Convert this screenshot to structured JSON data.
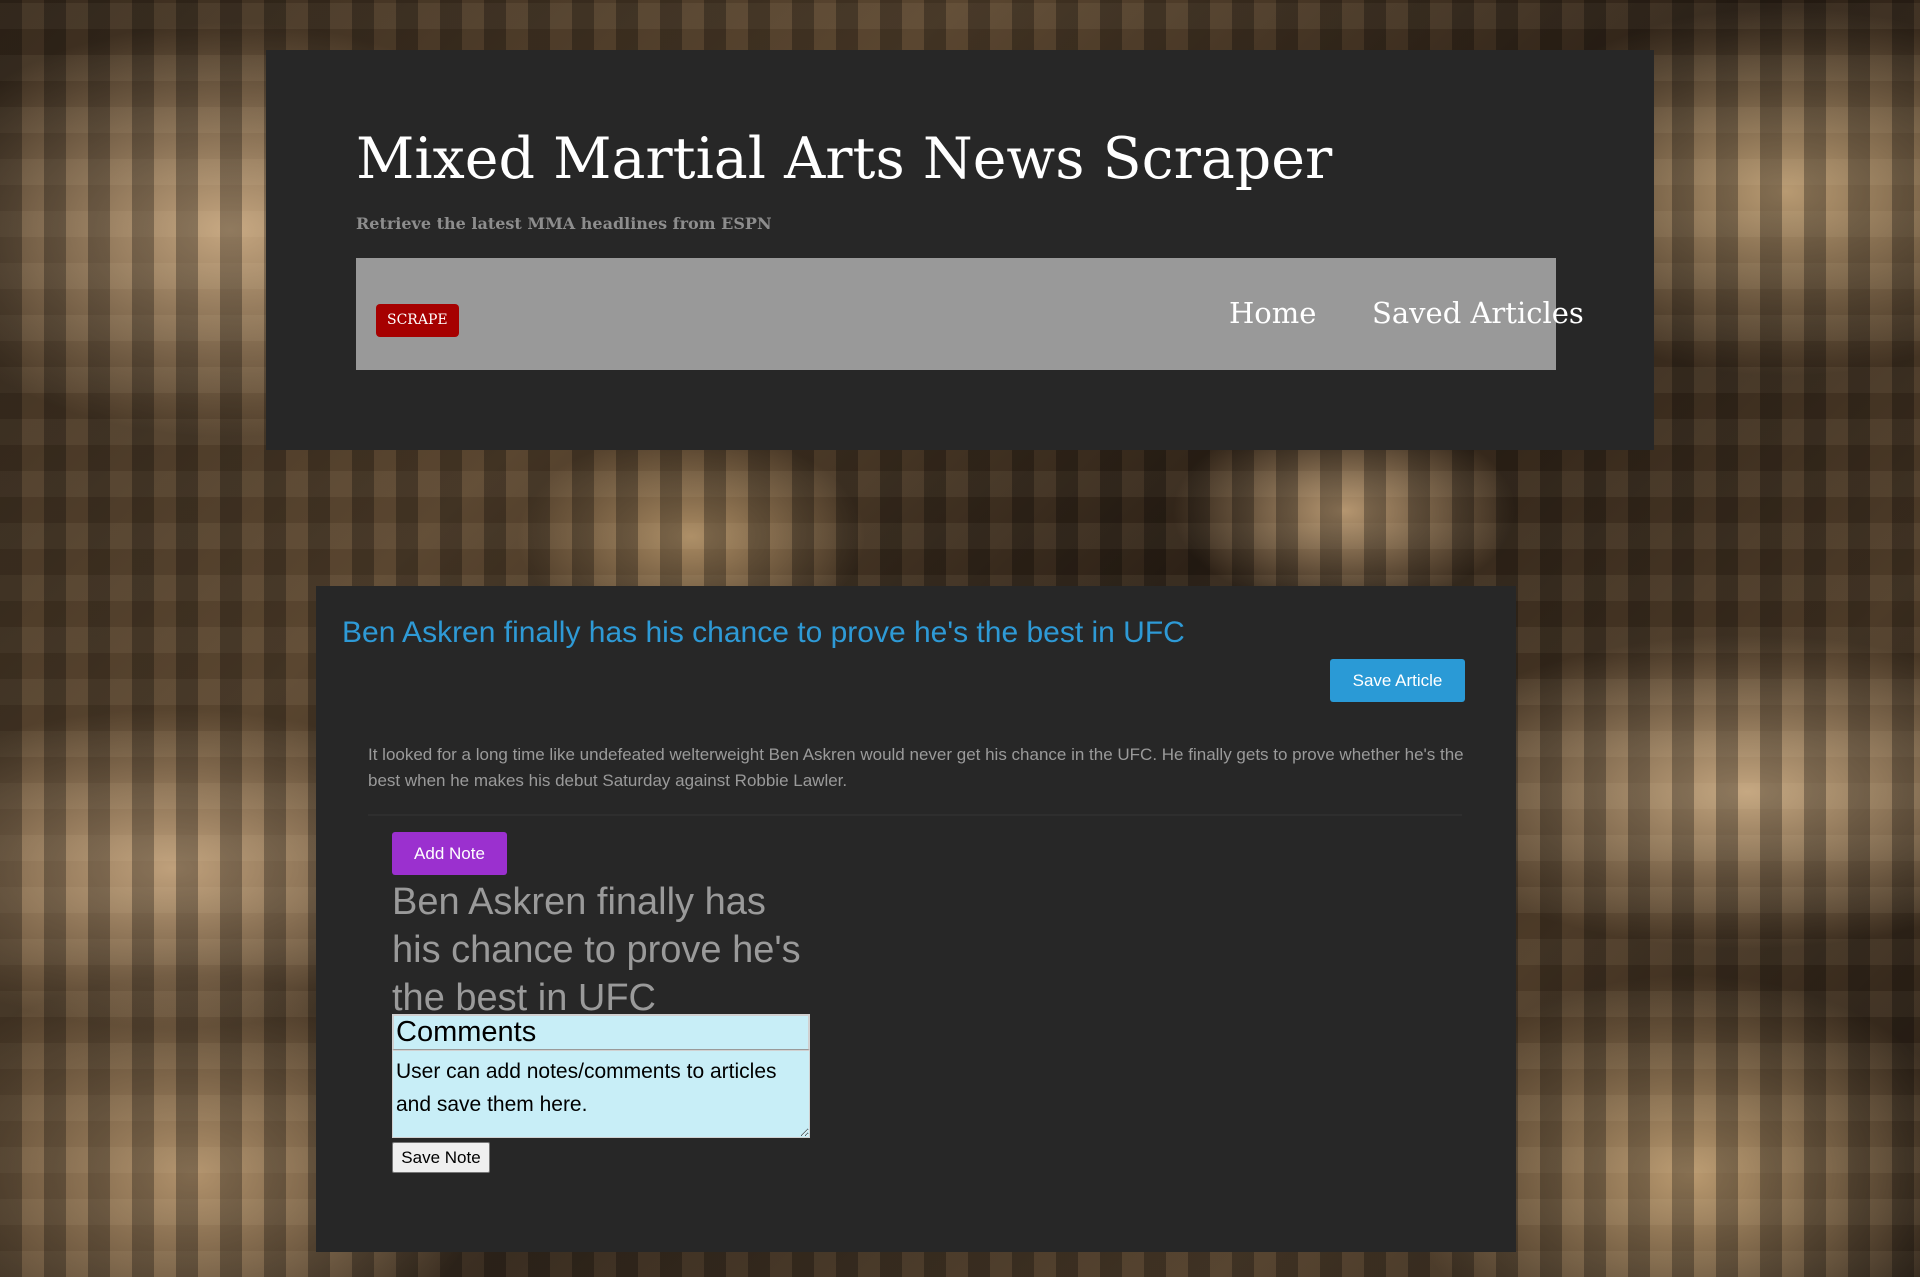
{
  "header": {
    "title": "Mixed Martial Arts News Scraper",
    "subtitle": "Retrieve the latest MMA headlines from ESPN"
  },
  "nav": {
    "scrape_label": "SCRAPE",
    "links": [
      "Home",
      "Saved Articles"
    ]
  },
  "article": {
    "title": "Ben Askren finally has his chance to prove he's the best in UFC",
    "save_label": "Save Article",
    "summary": "It looked for a long time like undefeated welterweight Ben Askren would never get his chance in the UFC. He finally gets to prove whether he's the best when he makes his debut Saturday against Robbie Lawler."
  },
  "note": {
    "add_label": "Add Note",
    "title": "Ben Askren finally has his chance to prove he's the best in UFC",
    "title_input_value": "Comments",
    "body_value": "User can add notes/comments to articles and save them here.",
    "save_label": "Save Note"
  },
  "colors": {
    "panel_bg": "#272727",
    "navbar_bg": "#999999",
    "scrape_red": "#a60000",
    "link_blue": "#2e9ad6",
    "note_purple": "#9b30cf",
    "input_bg": "#c8eef7"
  }
}
